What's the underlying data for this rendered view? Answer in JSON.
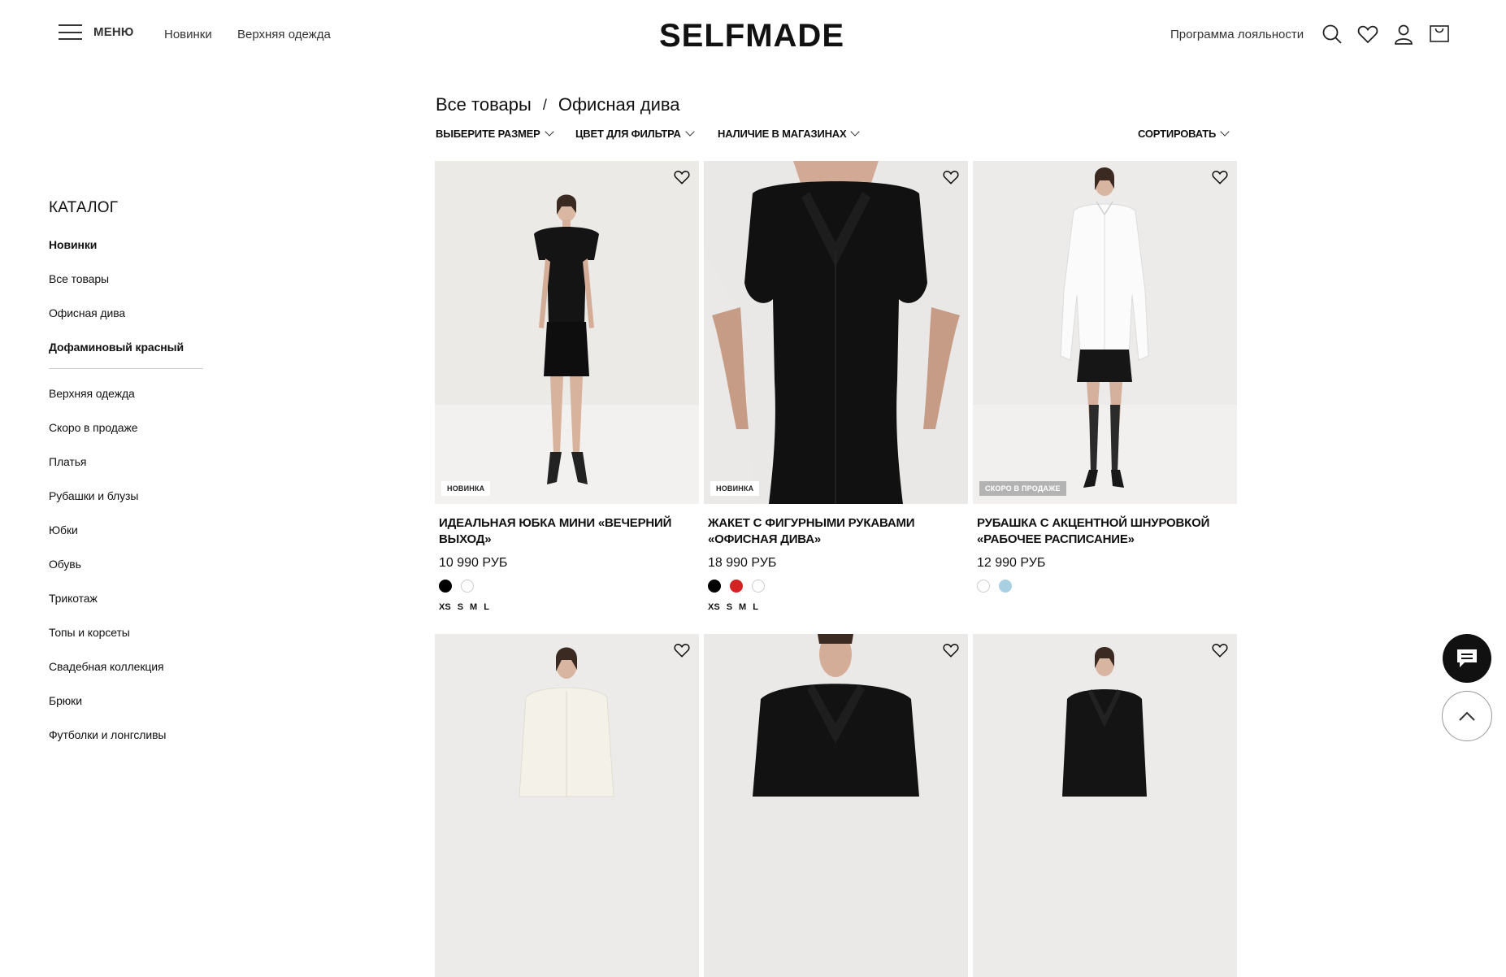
{
  "header": {
    "menu_label": "МЕНЮ",
    "nav": [
      "Новинки",
      "Верхняя одежда"
    ],
    "logo": "SELFMADE",
    "loyalty": "Программа лояльности",
    "icons": [
      "search-icon",
      "heart-icon",
      "user-icon",
      "cart-icon"
    ]
  },
  "breadcrumb": {
    "items": [
      "Все товары",
      "Офисная дива"
    ],
    "separator": "/"
  },
  "filters": {
    "size": "ВЫБЕРИТЕ РАЗМЕР",
    "color": "ЦВЕТ ДЛЯ ФИЛЬТРА",
    "stores": "НАЛИЧИЕ В МАГАЗИНАХ",
    "sort": "СОРТИРОВАТЬ"
  },
  "sidebar": {
    "title": "КАТАЛОГ",
    "top_items": [
      {
        "label": "Новинки",
        "bold": true
      },
      {
        "label": "Все товары",
        "bold": false
      },
      {
        "label": "Офисная дива",
        "bold": false
      },
      {
        "label": "Дофаминовый красный",
        "bold": true
      }
    ],
    "items": [
      "Верхняя одежда",
      "Скоро в продаже",
      "Платья",
      "Рубашки и блузы",
      "Юбки",
      "Обувь",
      "Трикотаж",
      "Топы и корсеты",
      "Свадебная коллекция",
      "Брюки",
      "Футболки и лонгсливы"
    ]
  },
  "products": [
    {
      "badge": "НОВИНКА",
      "name": "ИДЕАЛЬНАЯ ЮБКА МИНИ «ВЕЧЕРНИЙ ВЫХОД»",
      "price": "10 990 РУБ",
      "colors": [
        "#000000",
        "#ffffff"
      ],
      "sizes": [
        "XS",
        "S",
        "M",
        "L"
      ]
    },
    {
      "badge": "НОВИНКА",
      "name": "ЖАКЕТ С ФИГУРНЫМИ РУКАВАМИ «ОФИСНАЯ ДИВА»",
      "price": "18 990 РУБ",
      "colors": [
        "#000000",
        "#d42323",
        "#ffffff"
      ],
      "sizes": [
        "XS",
        "S",
        "M",
        "L"
      ]
    },
    {
      "badge": "СКОРО В ПРОДАЖЕ",
      "name": "РУБАШКА С АКЦЕНТНОЙ ШНУРОВКОЙ «РАБОЧЕЕ РАСПИСАНИЕ»",
      "price": "12 990 РУБ",
      "colors": [
        "#ffffff",
        "#a9cfe3"
      ],
      "sizes": []
    }
  ],
  "floating": {
    "chat_icon": "chat-icon",
    "scroll_top_icon": "chevron-up-icon"
  }
}
